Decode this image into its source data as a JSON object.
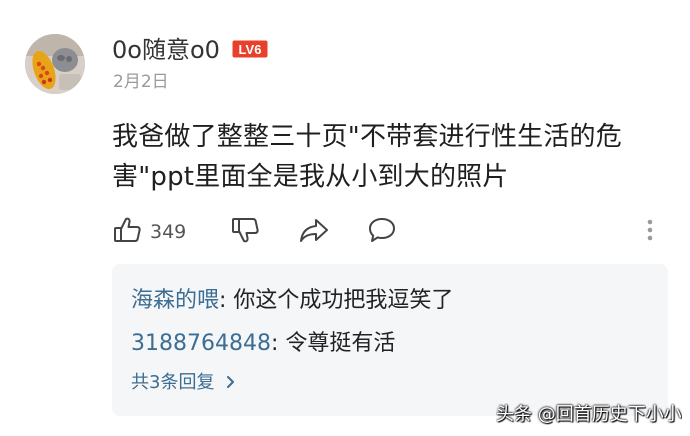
{
  "comment": {
    "username": "0o随意o0",
    "level_badge": "LV6",
    "date": "2月2日",
    "text": "我爸做了整整三十页\"不带套进行性生活的危害\"ppt里面全是我从小到大的照片",
    "like_count": "349"
  },
  "icons": {
    "like": "thumbs-up-icon",
    "dislike": "thumbs-down-icon",
    "share": "share-icon",
    "comment": "comment-icon",
    "more": "more-vertical-icon"
  },
  "replies": [
    {
      "name": "海森的喂",
      "separator": ": ",
      "text": "你这个成功把我逗笑了"
    },
    {
      "name": "3188764848",
      "separator": ": ",
      "text": "令尊挺有活"
    }
  ],
  "more_replies_label": "共3条回复",
  "watermark": "头条 @回首历史下小小",
  "colors": {
    "link": "#3d6d92",
    "badge": "#e8402a",
    "reply_bg": "#f5f6f8",
    "date": "#9a9a9a"
  }
}
